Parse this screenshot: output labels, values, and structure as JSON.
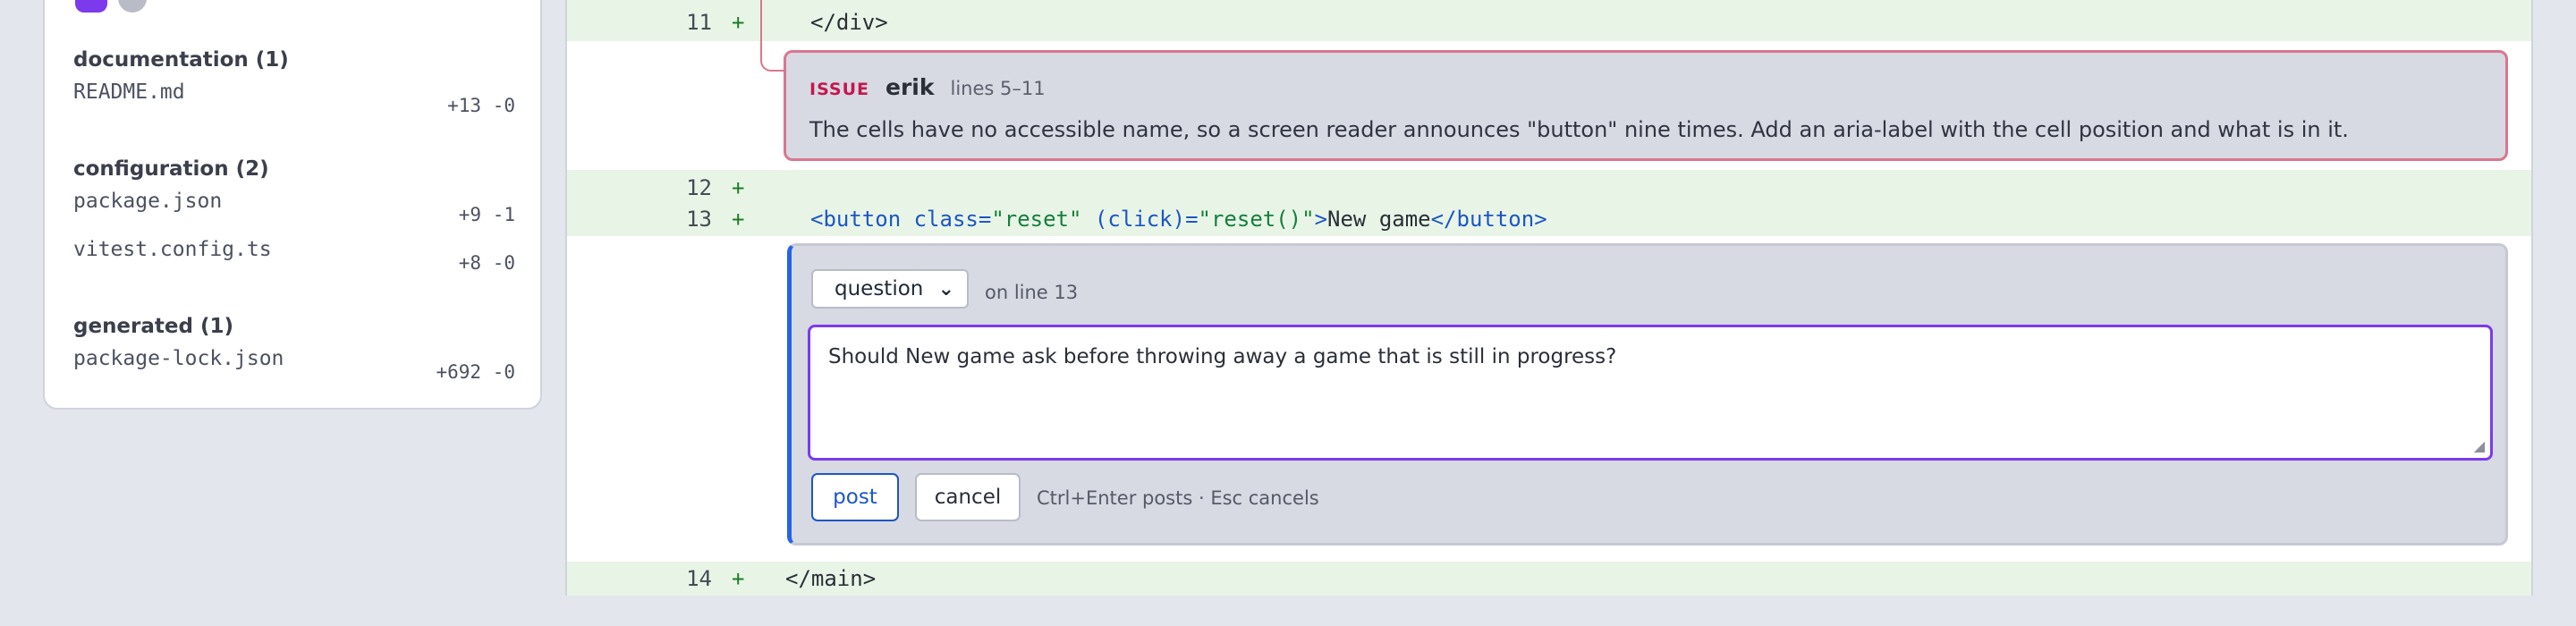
{
  "sidebar": {
    "groups": [
      {
        "title": "documentation (1)",
        "files": [
          {
            "name": "README.md",
            "stats": "+13 -0"
          }
        ]
      },
      {
        "title": "configuration (2)",
        "files": [
          {
            "name": "package.json",
            "stats": "+9 -1"
          },
          {
            "name": "vitest.config.ts",
            "stats": "+8 -0"
          }
        ]
      },
      {
        "title": "generated (1)",
        "files": [
          {
            "name": "package-lock.json",
            "stats": "+692 -0"
          }
        ]
      }
    ]
  },
  "diff": {
    "lines": [
      {
        "number": "11",
        "sign": "+"
      },
      {
        "number": "12",
        "sign": "+"
      },
      {
        "number": "13",
        "sign": "+"
      },
      {
        "number": "14",
        "sign": "+"
      }
    ],
    "code": {
      "l11_close_div": "</div>",
      "l13_open": "<button",
      "l13_class_attr": " class=",
      "l13_class_val": "\"reset\"",
      "l13_click_attr": " (click)=",
      "l13_click_val": "\"reset()\"",
      "l13_gt": ">",
      "l13_text": "New game",
      "l13_close": "</button>",
      "l14_close_main": "</main>"
    }
  },
  "issue": {
    "kind": "ISSUE",
    "author": "erik",
    "lines": "lines 5–11",
    "body": "The cells have no accessible name, so a screen reader announces \"button\" nine times. Add an aria-label with the cell position and what is in it."
  },
  "composer": {
    "kind_selected": "question",
    "on_line": "on line 13",
    "text": "Should New game ask before throwing away a game that is still in progress?",
    "post_label": "post",
    "cancel_label": "cancel",
    "hint": "Ctrl+Enter posts · Esc cancels"
  },
  "colors": {
    "accent_purple": "#7c3aed",
    "accent_blue": "#2563eb",
    "issue_red": "#c2184d",
    "added_line_bg": "#e8f5e6"
  }
}
